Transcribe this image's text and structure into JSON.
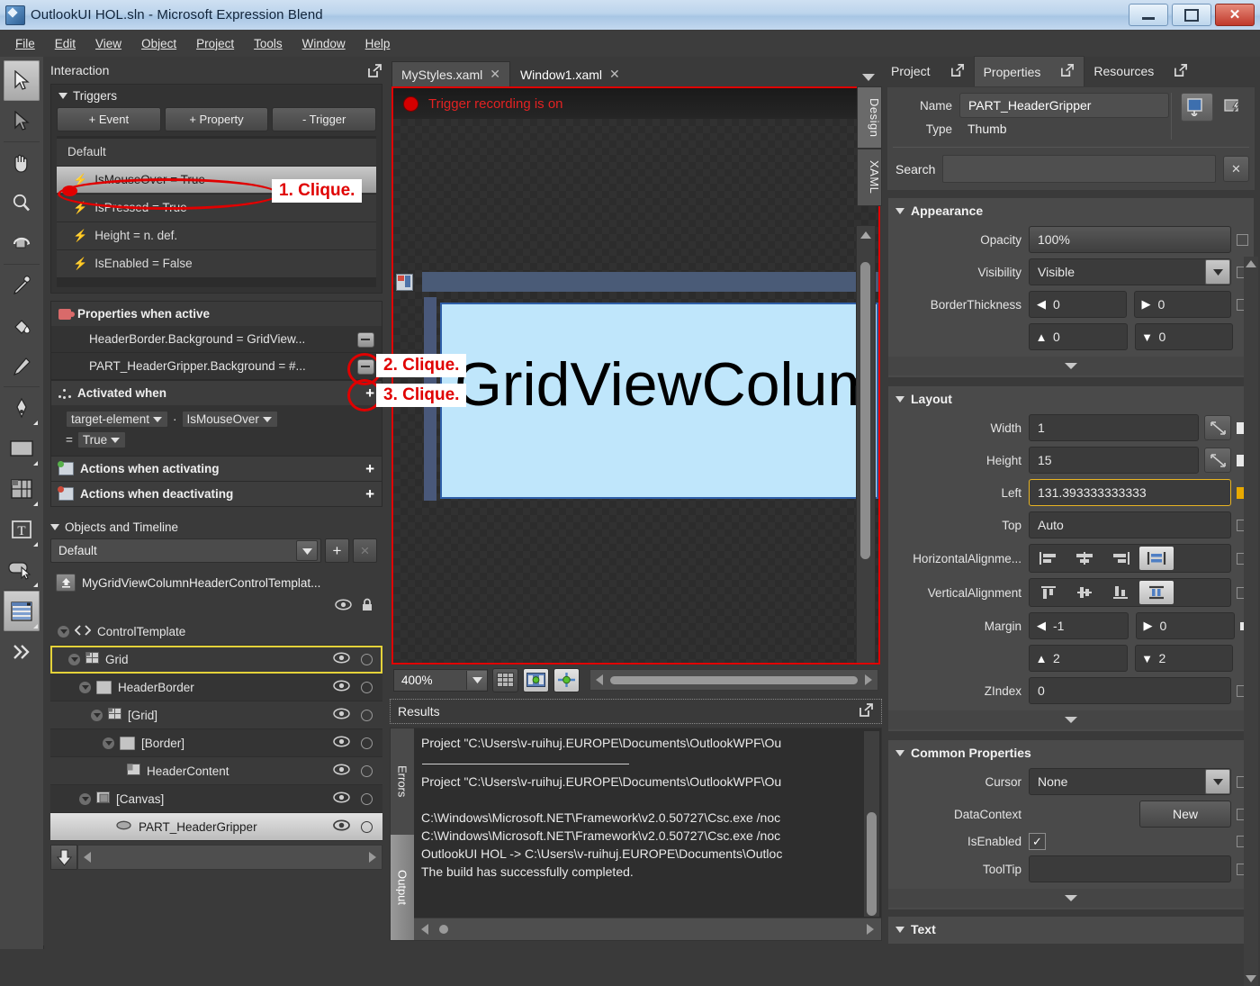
{
  "window": {
    "title": "OutlookUI HOL.sln - Microsoft Expression Blend",
    "app_icon": "blend-app-icon",
    "minimize": "minimize-icon",
    "maximize": "maximize-icon",
    "close": "close-icon"
  },
  "menu": {
    "items": [
      "File",
      "Edit",
      "View",
      "Object",
      "Project",
      "Tools",
      "Window",
      "Help"
    ]
  },
  "toolbar": {
    "tools": [
      {
        "name": "selection-tool",
        "selected": true
      },
      {
        "name": "direct-selection-tool",
        "selected": false
      },
      {
        "name": "pan-tool",
        "selected": false
      },
      {
        "name": "zoom-tool",
        "selected": false
      },
      {
        "name": "camera-orbit-tool",
        "selected": false
      },
      {
        "name": "eyedropper-tool",
        "selected": false
      },
      {
        "name": "paint-bucket-tool",
        "selected": false
      },
      {
        "name": "brush-tool",
        "selected": false
      },
      {
        "name": "pen-tool",
        "selected": false
      },
      {
        "name": "rectangle-tool",
        "selected": false
      },
      {
        "name": "grid-layout-tool",
        "selected": false
      },
      {
        "name": "text-tool",
        "selected": false
      },
      {
        "name": "button-control-tool",
        "selected": false
      },
      {
        "name": "listbox-asset-tool",
        "selected": true
      },
      {
        "name": "more-assets-tool",
        "selected": false
      }
    ]
  },
  "interaction": {
    "title": "Interaction",
    "triggers": {
      "title": "Triggers",
      "buttons": [
        "+ Event",
        "+ Property",
        "- Trigger"
      ],
      "rows": [
        {
          "label": "Default",
          "icon": false,
          "selected": false
        },
        {
          "label": "IsMouseOver = True",
          "icon": true,
          "selected": true
        },
        {
          "label": "IsPressed = True",
          "icon": true,
          "selected": false
        },
        {
          "label": "Height = n. def.",
          "icon": true,
          "selected": false
        },
        {
          "label": "IsEnabled = False",
          "icon": true,
          "selected": false
        }
      ]
    },
    "properties_when_active": {
      "title": "Properties when active",
      "rows": [
        "HeaderBorder.Background = GridView...",
        "PART_HeaderGripper.Background = #..."
      ]
    },
    "activated_when": {
      "title": "Activated when",
      "target": "target-element",
      "separator": "·",
      "property": "IsMouseOver",
      "equals": "=",
      "value": "True"
    },
    "actions_activating": "Actions when activating",
    "actions_deactivating": "Actions when deactivating",
    "objects_timeline": {
      "title": "Objects and Timeline",
      "storyboard": "Default",
      "add_label": "+",
      "remove_label": "×",
      "root": "MyGridViewColumnHeaderControlTemplat...",
      "nodes": [
        {
          "label": "ControlTemplate",
          "indent": 0,
          "icon": "code-icon",
          "expander": true,
          "selected": "none",
          "eye": false
        },
        {
          "label": "Grid",
          "indent": 1,
          "icon": "grid-icon",
          "expander": true,
          "selected": "yellow",
          "eye": true
        },
        {
          "label": "HeaderBorder",
          "indent": 2,
          "icon": "border-icon",
          "expander": true,
          "selected": "none",
          "eye": true
        },
        {
          "label": "[Grid]",
          "indent": 3,
          "icon": "grid-icon",
          "expander": true,
          "selected": "none",
          "eye": true
        },
        {
          "label": "[Border]",
          "indent": 4,
          "icon": "border-icon",
          "expander": true,
          "selected": "none",
          "eye": true
        },
        {
          "label": "HeaderContent",
          "indent": 5,
          "icon": "content-icon",
          "expander": false,
          "selected": "none",
          "eye": true
        },
        {
          "label": "[Canvas]",
          "indent": 2,
          "icon": "canvas-icon",
          "expander": true,
          "selected": "none",
          "eye": true
        },
        {
          "label": "PART_HeaderGripper",
          "indent": 3,
          "icon": "thumb-icon",
          "expander": false,
          "selected": "white",
          "eye": true
        }
      ]
    }
  },
  "center": {
    "tabs": [
      {
        "label": "MyStyles.xaml",
        "active": false
      },
      {
        "label": "Window1.xaml",
        "active": true
      }
    ],
    "recording_text": "Trigger recording is on",
    "artboard_label": "GridViewColumr",
    "side_tabs": [
      {
        "label": "Design",
        "active": true
      },
      {
        "label": "XAML",
        "active": false
      }
    ],
    "zoom_level": "400%",
    "zoom_buttons": [
      "snap-grid-icon",
      "snap-to-objects-icon",
      "snap-to-gridlines-icon"
    ],
    "results": {
      "title": "Results",
      "tabs": [
        {
          "label": "Errors",
          "active": false
        },
        {
          "label": "Output",
          "active": true
        }
      ],
      "lines": [
        "Project \"C:\\Users\\v-ruihuj.EUROPE\\Documents\\OutlookWPF\\Ou",
        "Project \"C:\\Users\\v-ruihuj.EUROPE\\Documents\\OutlookWPF\\Ou",
        "C:\\Windows\\Microsoft.NET\\Framework\\v2.0.50727\\Csc.exe /noc",
        "C:\\Windows\\Microsoft.NET\\Framework\\v2.0.50727\\Csc.exe /noc",
        "OutlookUI HOL -> C:\\Users\\v-ruihuj.EUROPE\\Documents\\Outloc",
        "The build has successfully completed."
      ]
    }
  },
  "right": {
    "tabs": [
      {
        "label": "Project",
        "active": false
      },
      {
        "label": "Properties",
        "active": true
      },
      {
        "label": "Resources",
        "active": false
      }
    ],
    "identity": {
      "name_label": "Name",
      "name_value": "PART_HeaderGripper",
      "type_label": "Type",
      "type_value": "Thumb",
      "search_label": "Search",
      "search_value": "",
      "search_placeholder": ""
    },
    "appearance": {
      "title": "Appearance",
      "opacity_label": "Opacity",
      "opacity_value": "100%",
      "visibility_label": "Visibility",
      "visibility_value": "Visible",
      "border_thickness_label": "BorderThickness",
      "border_left": "0",
      "border_right": "0",
      "border_top": "0",
      "border_bottom": "0"
    },
    "layout": {
      "title": "Layout",
      "width_label": "Width",
      "width_value": "1",
      "height_label": "Height",
      "height_value": "15",
      "left_label": "Left",
      "left_value": "131.393333333333",
      "top_label": "Top",
      "top_value": "Auto",
      "halign_label": "HorizontalAlignme...",
      "halign_selected": 3,
      "valign_label": "VerticalAlignment",
      "valign_selected": 3,
      "margin_label": "Margin",
      "margin_left": "-1",
      "margin_right": "0",
      "margin_top": "2",
      "margin_bottom": "2",
      "zindex_label": "ZIndex",
      "zindex_value": "0"
    },
    "common": {
      "title": "Common Properties",
      "cursor_label": "Cursor",
      "cursor_value": "None",
      "datacontext_label": "DataContext",
      "datacontext_button": "New",
      "isenabled_label": "IsEnabled",
      "isenabled_checked": true,
      "tooltip_label": "ToolTip",
      "tooltip_value": ""
    },
    "text_section": {
      "title": "Text"
    }
  },
  "annotations": [
    {
      "id": "a1",
      "text": "1. Clique."
    },
    {
      "id": "a2",
      "text": "2. Clique."
    },
    {
      "id": "a3",
      "text": "3. Clique."
    }
  ],
  "colors": {
    "accent_red": "#e00000",
    "panel_bg": "#3a3a3a",
    "field_bg": "#3b3b3b",
    "highlight_gold": "#e8b422",
    "artboard_blue": "#bfe6fb"
  }
}
